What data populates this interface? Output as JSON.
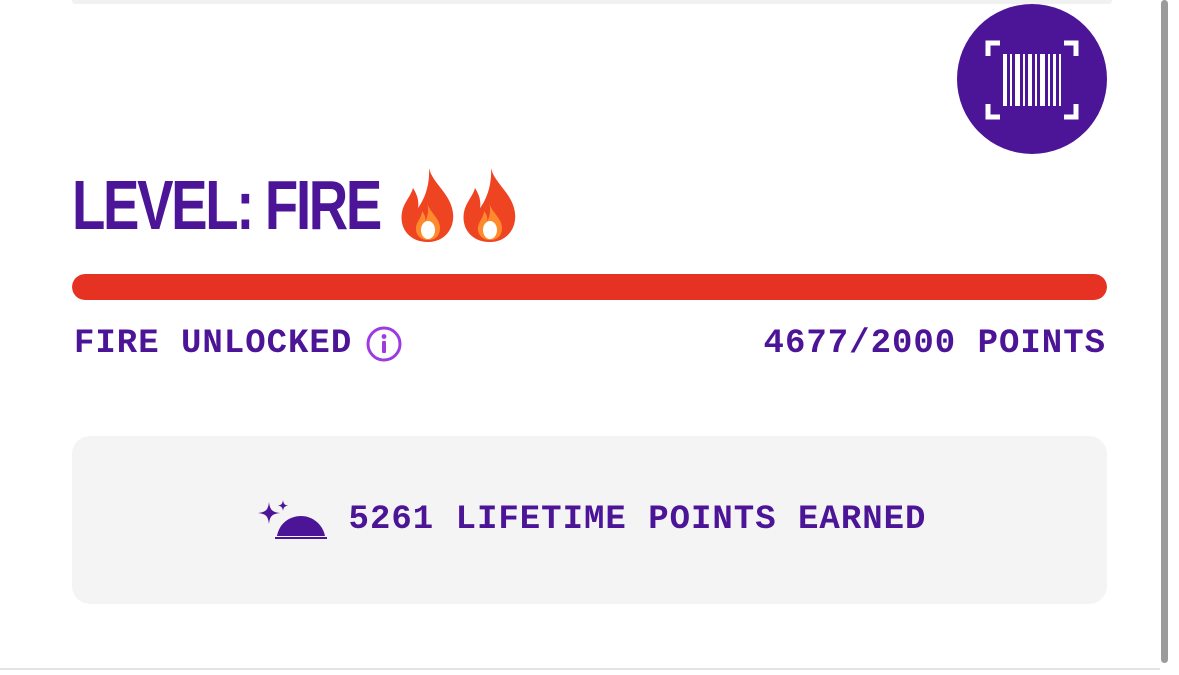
{
  "level": {
    "title": "LEVEL: FIRE",
    "badge_icons": [
      "fire-emoji",
      "fire-emoji"
    ]
  },
  "progress": {
    "status_label": "FIRE UNLOCKED",
    "points_text": "4677/2000 POINTS",
    "current_points": 4677,
    "target_points": 2000,
    "fill_fraction": 1.0
  },
  "lifetime": {
    "text": "5261 LIFETIME POINTS EARNED",
    "icon": "sparkle-taco-icon"
  },
  "scan_button": {
    "icon": "barcode-scan-icon"
  },
  "colors": {
    "brand_purple": "#4c1597",
    "progress_red": "#e53222",
    "info_purple": "#9b3be0",
    "card_background": "#f4f4f4"
  }
}
